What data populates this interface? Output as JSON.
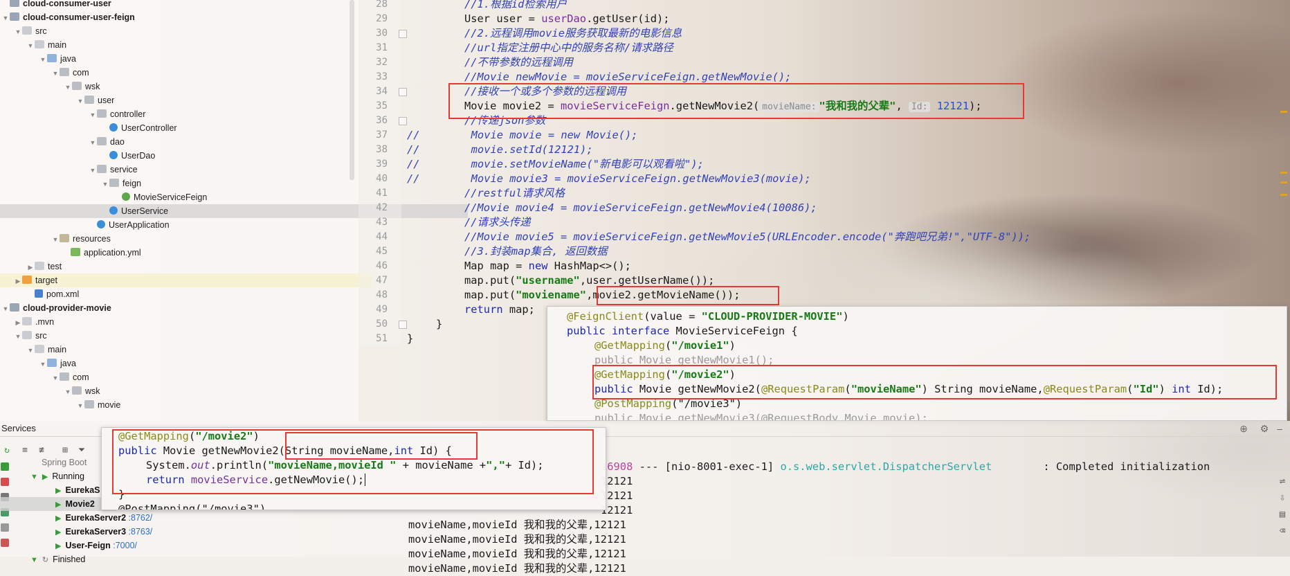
{
  "project_tree": {
    "items": [
      {
        "label": "cloud-consumer-user",
        "bold": true
      },
      {
        "label": "cloud-consumer-user-feign",
        "bold": true
      },
      {
        "label": "src"
      },
      {
        "label": "main"
      },
      {
        "label": "java"
      },
      {
        "label": "com"
      },
      {
        "label": "wsk"
      },
      {
        "label": "user"
      },
      {
        "label": "controller"
      },
      {
        "label": "UserController"
      },
      {
        "label": "dao"
      },
      {
        "label": "UserDao"
      },
      {
        "label": "service"
      },
      {
        "label": "feign"
      },
      {
        "label": "MovieServiceFeign"
      },
      {
        "label": "UserService"
      },
      {
        "label": "UserApplication"
      },
      {
        "label": "resources"
      },
      {
        "label": "application.yml"
      },
      {
        "label": "test"
      },
      {
        "label": "target"
      },
      {
        "label": "pom.xml"
      },
      {
        "label": "cloud-provider-movie",
        "bold": true
      },
      {
        "label": ".mvn"
      },
      {
        "label": "src"
      },
      {
        "label": "main"
      },
      {
        "label": "java"
      },
      {
        "label": "com"
      },
      {
        "label": "wsk"
      },
      {
        "label": "movie"
      }
    ]
  },
  "editor": {
    "line_numbers": [
      "28",
      "29",
      "30",
      "31",
      "32",
      "33",
      "34",
      "35",
      "36",
      "37",
      "38",
      "39",
      "40",
      "41",
      "42",
      "43",
      "44",
      "45",
      "46",
      "47",
      "48",
      "49",
      "50",
      "51"
    ],
    "lines": {
      "l28": "//1.根据id检索用户",
      "l29a": "User user = ",
      "l29b": "userDao",
      "l29c": ".getUser(id);",
      "l30": "//2.远程调用movie服务获取最新的电影信息",
      "l31": "//url指定注册中心中的服务名称/请求路径",
      "l32": "//不带参数的远程调用",
      "l33": "//Movie newMovie = movieServiceFeign.getNewMovie();",
      "l34": "//接收一个或多个参数的远程调用",
      "l35a": "Movie movie2 = ",
      "l35b": "movieServiceFeign",
      "l35c": ".getNewMovie2(",
      "l35hint1": "movieName:",
      "l35str": "\"我和我的父辈\"",
      "l35sep": ", ",
      "l35hint2": "Id:",
      "l35num": "12121",
      "l35end": ");",
      "l36": "//传递json参数",
      "l37": "//        Movie movie = new Movie();",
      "l38": "//        movie.setId(12121);",
      "l39": "//        movie.setMovieName(\"新电影可以观看啦\");",
      "l40": "//        Movie movie3 = movieServiceFeign.getNewMovie3(movie);",
      "l41": "//restful请求风格",
      "l42": "//Movie movie4 = movieServiceFeign.getNewMovie4(10086);",
      "l43": "//请求头传递",
      "l44": "//Movie movie5 = movieServiceFeign.getNewMovie5(URLEncoder.encode(\"奔跑吧兄弟!\",\"UTF-8\"));",
      "l45": "//3.封装map集合, 返回数据",
      "l46a": "Map map = ",
      "l46b": "new",
      "l46c": " HashMap<>();",
      "l47a": "map.put(",
      "l47b": "\"username\"",
      "l47c": ",user.getUserName());",
      "l48a": "map.put(",
      "l48b": "\"moviename\"",
      "l48c": ",movie2.getMovieName());",
      "l49a": "return",
      "l49b": " map;",
      "l50": "}",
      "l51": "}"
    }
  },
  "feign_popup": {
    "l1a": "@FeignClient",
    "l1b": "(value = ",
    "l1c": "\"CLOUD-PROVIDER-MOVIE\"",
    "l1d": ")",
    "l2a": "public interface",
    "l2b": " MovieServiceFeign {",
    "l3a": "@GetMapping",
    "l3b": "(",
    "l3c": "\"/movie1\"",
    "l3d": ")",
    "l4": "public Movie getNewMovie1();",
    "l5a": "@GetMapping",
    "l5b": "(",
    "l5c": "\"/movie2\"",
    "l5d": ")",
    "l6a": "public",
    "l6b": " Movie getNewMovie2(",
    "l6c": "@RequestParam",
    "l6d": "(",
    "l6e": "\"movieName\"",
    "l6f": ") String movieName,",
    "l6g": "@RequestParam",
    "l6h": "(",
    "l6i": "\"Id\"",
    "l6j": ") ",
    "l6k": "int",
    "l6l": " Id);",
    "l7a": "@PostMapping",
    "l7b": "(\"/movie3\")",
    "l8": "public Movie getNewMovie3(@RequestBody Movie movie);"
  },
  "controller_popup": {
    "l1a": "@GetMapping",
    "l1b": "(",
    "l1c": "\"/movie2\"",
    "l1d": ")",
    "l2a": "public",
    "l2b": " Movie getNewMovie2(String movieName,",
    "l2c": "int",
    "l2d": " Id) {",
    "l3a": "System.",
    "l3b": "out",
    "l3c": ".println(",
    "l3d": "\"movieName,movieId \"",
    "l3e": " + movieName +",
    "l3f": "\",\"",
    "l3g": "+ Id);",
    "l4a": "return",
    "l4b": " ",
    "l4c": "movieService",
    "l4d": ".getNewMovie();",
    "l5": "}",
    "l6": "@PostMapping(\"/movie3\")"
  },
  "services": {
    "title": "Services",
    "tree": [
      {
        "label": "Spring Boot",
        "port": ""
      },
      {
        "label": "Running",
        "port": ""
      },
      {
        "label": "EurekaS",
        "port": ""
      },
      {
        "label": "Movie2",
        "port": ""
      },
      {
        "label": "EurekaServer2",
        "port": ":8762/"
      },
      {
        "label": "EurekaServer3",
        "port": ":8763/"
      },
      {
        "label": "User-Feign",
        "port": ":7000/"
      },
      {
        "label": "Finished",
        "port": ""
      }
    ],
    "console": {
      "init_pid": "16908",
      "init_thread": " --- [nio-8001-exec-1] ",
      "init_logger": "o.s.web.servlet.DispatcherServlet",
      "init_msg": "        : Completed initialization",
      "lines": [
        "12121",
        "12121",
        "movieName,movieId 我和我的父辈,12121",
        "movieName,movieId 我和我的父辈,12121",
        "movieName,movieId 我和我的父辈,12121",
        "movieName,movieId 我和我的父辈,12121"
      ],
      "partial": "12121"
    }
  },
  "colors": {
    "highlight_box": "#e53935",
    "comment": "#3242b8",
    "string": "#177a17",
    "number": "#1d4fe0"
  }
}
